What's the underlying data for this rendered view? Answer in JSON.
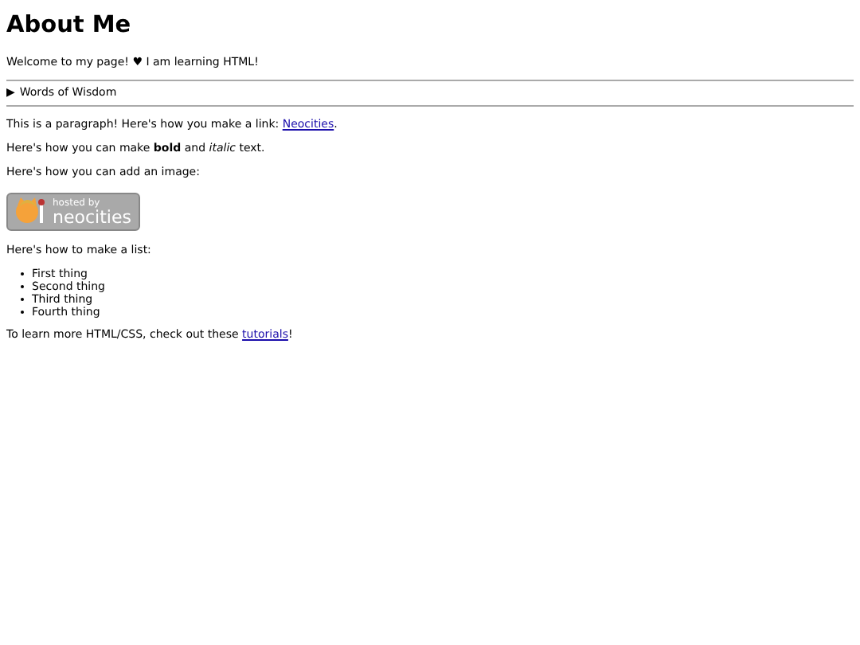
{
  "title": "About Me",
  "intro": "Welcome to my page! ♥ I am learning HTML!",
  "details": {
    "marker": "▶",
    "summary": "Words of Wisdom",
    "expanded": false
  },
  "link_paragraph": {
    "before": "This is a paragraph! Here's how you make a link: ",
    "link": "Neocities",
    "after": "."
  },
  "format_paragraph": "Here's how you can make **bold** and *italic* text.",
  "image_paragraph": "Here's how you can add an image:",
  "badge": {
    "line_1": "hosted by",
    "line_2": "neocities"
  },
  "list_paragraph": "Here's how to make a list:",
  "list": [
    "First thing",
    "Second thing",
    "Third thing",
    "Fourth thing"
  ],
  "outro": {
    "before": "To learn more HTML/CSS, check out these ",
    "link": "tutorials",
    "after": "!"
  }
}
